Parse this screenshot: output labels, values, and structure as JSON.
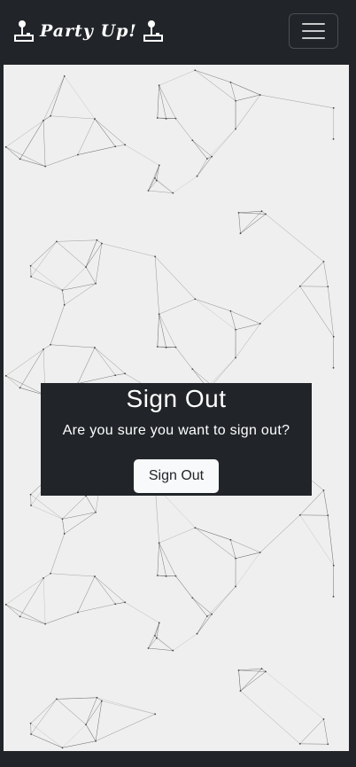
{
  "navbar": {
    "brand_text": "Party Up!",
    "left_icon": "joystick-icon",
    "right_icon": "joystick-icon",
    "toggler_icon": "hamburger-menu-icon"
  },
  "dialog": {
    "title": "Sign Out",
    "message": "Are you sure you want to sign out?",
    "button_label": "Sign Out"
  },
  "colors": {
    "navbar_bg": "#212529",
    "page_bg": "#efefef",
    "card_bg": "#212529",
    "button_bg": "#f8f9fa",
    "text_light": "#ffffff"
  }
}
